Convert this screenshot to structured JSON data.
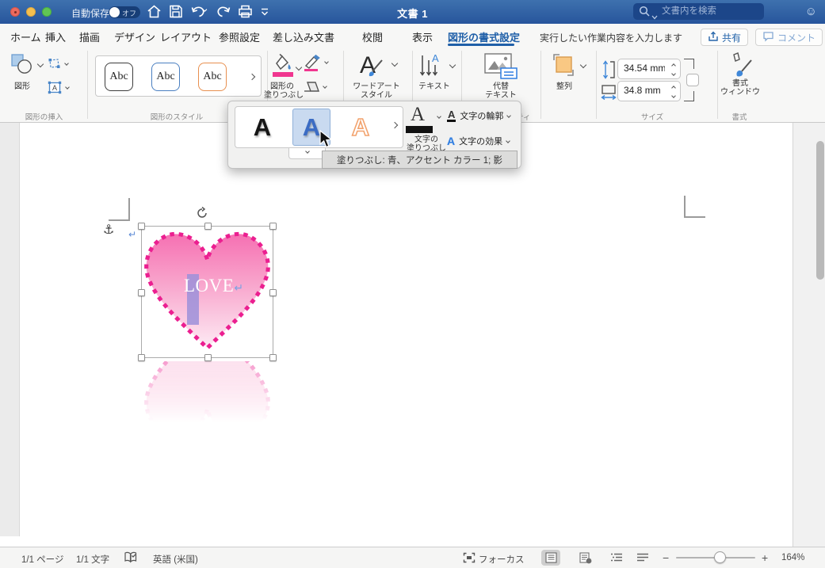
{
  "titlebar": {
    "title": "文書 1",
    "autosave_label": "自動保存",
    "autosave_state": "オフ",
    "search_placeholder": "文書内を検索"
  },
  "tabs": [
    {
      "label": "ホーム"
    },
    {
      "label": "挿入"
    },
    {
      "label": "描画"
    },
    {
      "label": "デザイン"
    },
    {
      "label": "レイアウト"
    },
    {
      "label": "参照設定"
    },
    {
      "label": "差し込み文書"
    },
    {
      "label": "校閲"
    },
    {
      "label": "表示"
    },
    {
      "label": "図形の書式設定"
    }
  ],
  "tab_hint": "実行したい作業内容を入力します",
  "actions": {
    "share": "共有",
    "comment": "コメント"
  },
  "ribbon": {
    "insert_shapes": {
      "group_label": "図形の挿入",
      "shapes_button": "図形"
    },
    "shape_styles": {
      "group_label": "図形のスタイル",
      "samples": [
        "Abc",
        "Abc",
        "Abc"
      ]
    },
    "fill": {
      "label_line1": "図形の",
      "label_line2": "塗りつぶし"
    },
    "wordart": {
      "label_line1": "ワードアート",
      "label_line2": "スタイル"
    },
    "text": {
      "label": "テキスト"
    },
    "alt_text": {
      "label_line1": "代替",
      "label_line2": "テキスト",
      "group_label": "アクセシビリティ"
    },
    "arrange": {
      "align_label": "整列"
    },
    "size": {
      "group_label": "サイズ",
      "height_value": "34.54 mm",
      "width_value": "34.8 mm"
    },
    "format": {
      "label_line1": "書式",
      "label_line2": "ウィンドウ",
      "group_label": "書式"
    }
  },
  "popup": {
    "gallery": [
      "A",
      "A",
      "A"
    ],
    "text_fill_line1": "文字の",
    "text_fill_line2": "塗りつぶし",
    "text_outline_label": "文字の輪郭",
    "text_effects_label": "文字の効果",
    "tooltip": "塗りつぶし: 青、アクセント カラー 1; 影"
  },
  "document": {
    "shape_text": "LOVE"
  },
  "statusbar": {
    "page_count": "1/1 ページ",
    "char_count": "1/1 文字",
    "language": "英語 (米国)",
    "focus_label": "フォーカス",
    "zoom_level": "164%"
  },
  "icons": {
    "anchor": "⚓",
    "smiley": "☺",
    "return_mark": "↵"
  },
  "colors": {
    "titlebar_blue": "#2f5f9f",
    "accent_blue": "#1f5fa8",
    "heart_stroke": "#eb1f90",
    "heart_gradient_top": "#f670b2",
    "heart_gradient_bottom": "#fdebf4",
    "selection_highlight": "#9c91d9",
    "pink_swatch": "#f0368f",
    "align_orange": "#f9c883"
  }
}
